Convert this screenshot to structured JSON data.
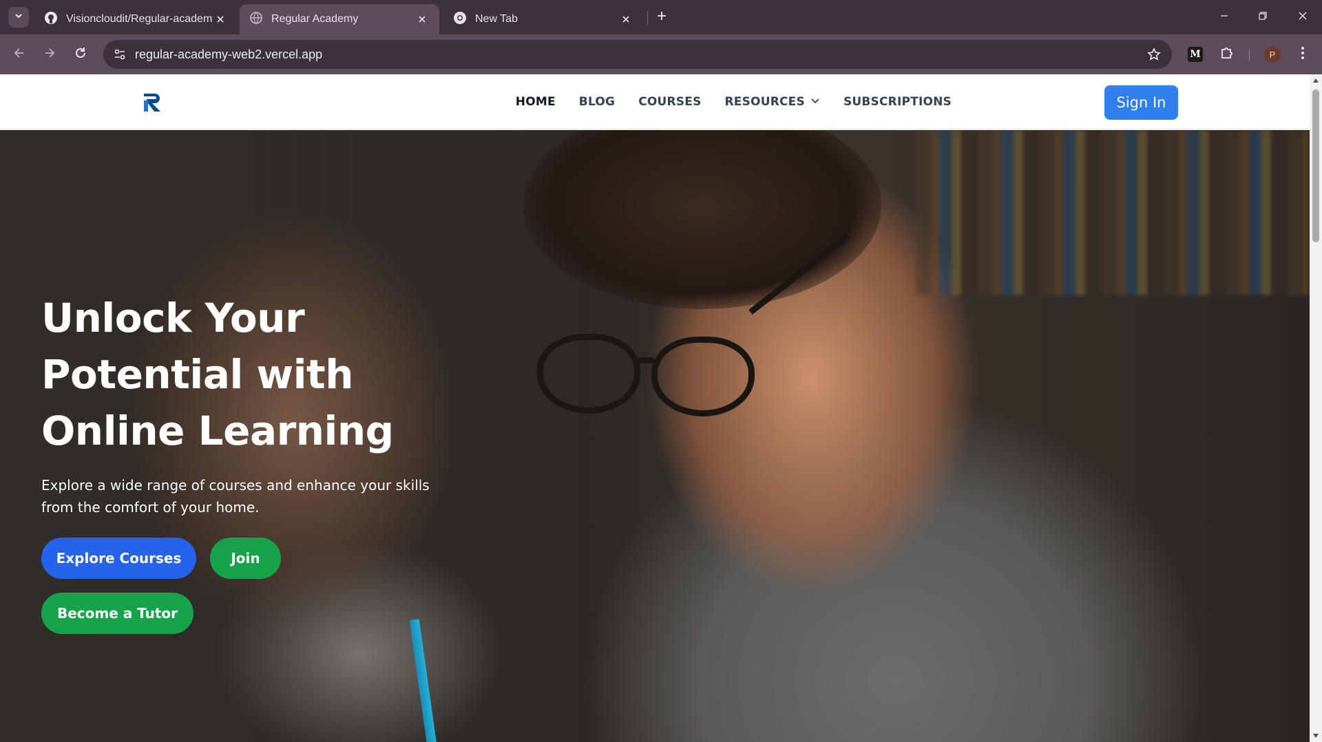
{
  "browser": {
    "tabs": [
      {
        "title": "Visioncloudit/Regular-academy",
        "icon": "github-icon"
      },
      {
        "title": "Regular Academy",
        "icon": "globe-icon",
        "active": true
      },
      {
        "title": "New Tab",
        "icon": "chrome-icon"
      }
    ],
    "url": "regular-academy-web2.vercel.app",
    "extension_label": "M",
    "profile_initial": "P"
  },
  "site": {
    "nav": [
      {
        "label": "HOME",
        "active": true
      },
      {
        "label": "BLOG"
      },
      {
        "label": "COURSES"
      },
      {
        "label": "RESOURCES",
        "has_dropdown": true
      },
      {
        "label": "SUBSCRIPTIONS"
      }
    ],
    "sign_in_label": "Sign In",
    "accent_color": "#2f80ed",
    "hero": {
      "title_lines": [
        "Unlock Your",
        "Potential with",
        "Online Learning"
      ],
      "subtitle_lines": [
        "Explore a wide range of courses and enhance your skills",
        "from the comfort of your home."
      ],
      "buttons": {
        "explore": "Explore Courses",
        "join": "Join",
        "tutor": "Become a Tutor"
      },
      "colors": {
        "primary": "#2563eb",
        "success": "#16a34a"
      }
    }
  }
}
